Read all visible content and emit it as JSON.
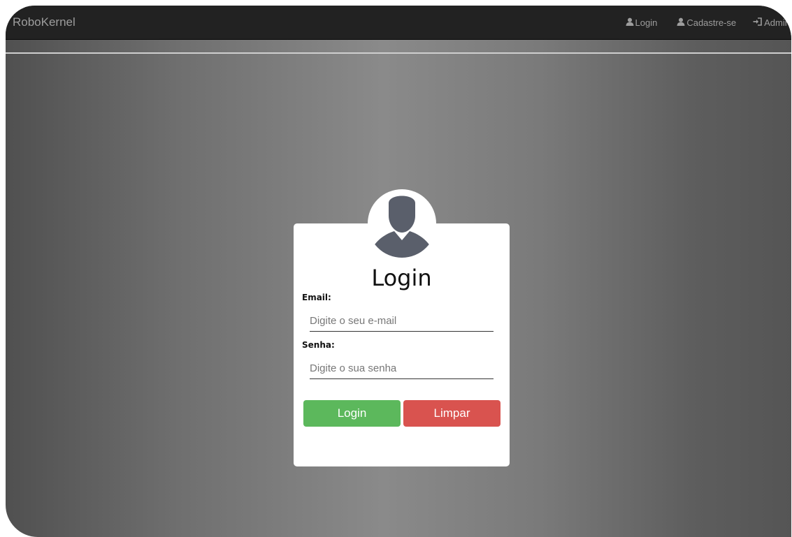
{
  "navbar": {
    "brand": "RoboKernel",
    "links": [
      {
        "label": "Login",
        "icon": "user-icon"
      },
      {
        "label": "Cadastre-se",
        "icon": "user-icon"
      },
      {
        "label": "Admin",
        "icon": "log-in-icon"
      }
    ]
  },
  "form": {
    "avatar_icon": "user-avatar-icon",
    "title": "Login",
    "email_label": "Email:",
    "email_placeholder": "Digite o seu e-mail",
    "password_label": "Senha:",
    "password_placeholder": "Digite o sua senha",
    "login_button": "Login",
    "clear_button": "Limpar"
  },
  "colors": {
    "navbar": "#222222",
    "login_button": "#5cb85c",
    "clear_button": "#d9534f",
    "avatar": "#5a5f6b"
  }
}
